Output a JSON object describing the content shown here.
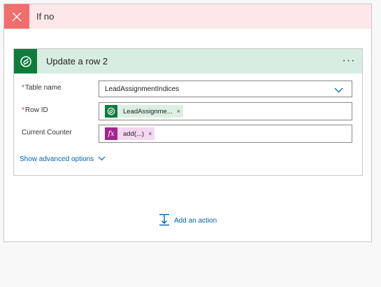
{
  "condition": {
    "title": "If no",
    "colors": {
      "header_bg": "#fde7e9",
      "icon_bg": "#f26d6d"
    },
    "icon": "close-icon"
  },
  "action": {
    "title": "Update a row 2",
    "icon": "dataverse-icon",
    "more_label": "···",
    "colors": {
      "header_bg": "#d8ede1",
      "icon_bg": "#0f7b3c"
    },
    "fields": {
      "table_name": {
        "label": "Table name",
        "required": true,
        "value": "LeadAssignmentIndices"
      },
      "row_id": {
        "label": "Row ID",
        "required": true,
        "token": "LeadAssignme...",
        "token_icon": "dataverse-icon"
      },
      "current_counter": {
        "label": "Current Counter",
        "required": false,
        "token": "add(...)",
        "token_icon": "fx-icon"
      }
    },
    "advanced_label": "Show advanced options"
  },
  "add_action_label": "Add an action",
  "required_mark": "*",
  "token_close": "×",
  "fx_label": "fx"
}
